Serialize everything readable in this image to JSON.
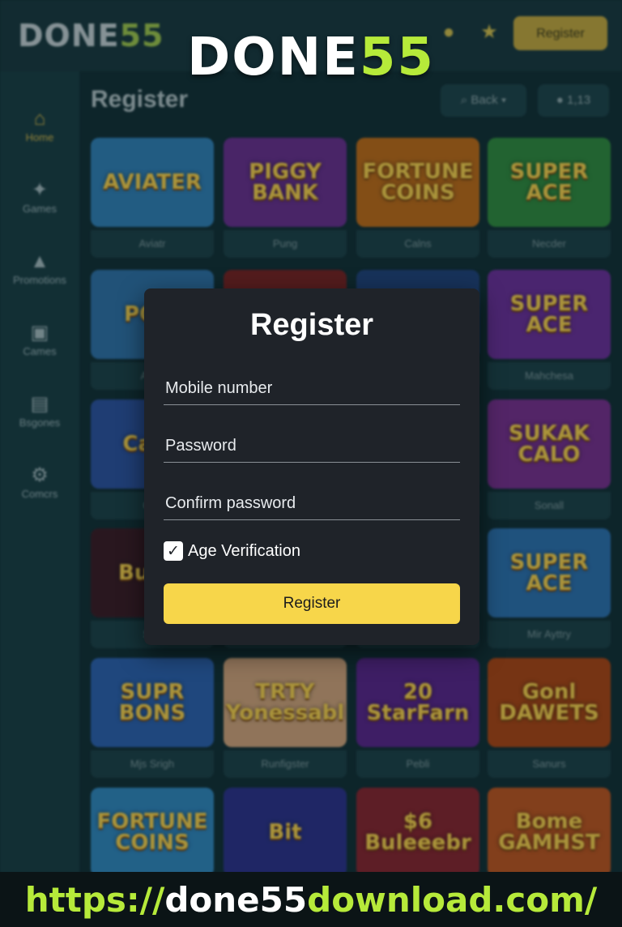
{
  "brand": {
    "prefix": "DONE",
    "suffix": "55"
  },
  "header": {
    "bell_icon": "bell-icon",
    "star_icon": "star-badge-icon",
    "register_label": "Register"
  },
  "sidebar": {
    "items": [
      {
        "label": "Home",
        "icon": "home-icon"
      },
      {
        "label": "Games",
        "icon": "games-icon"
      },
      {
        "label": "Promotions",
        "icon": "promotions-icon"
      },
      {
        "label": "Cames",
        "icon": "image-icon"
      },
      {
        "label": "Bsgones",
        "icon": "wallet-icon"
      },
      {
        "label": "Comcrs",
        "icon": "gear-icon"
      }
    ]
  },
  "main": {
    "heading": "Register",
    "filter_label": "Back",
    "count_label": "1,13",
    "tiles": [
      {
        "art": "AVIATER",
        "caption": "Aviatr",
        "bg": "#2f7fb8"
      },
      {
        "art": "PIGGY BANK",
        "caption": "Pung",
        "bg": "#6a2a8e"
      },
      {
        "art": "FORTUNE COINS",
        "caption": "Calns",
        "bg": "#c46a12"
      },
      {
        "art": "SUPER ACE",
        "caption": "Necder",
        "bg": "#2f8a3a"
      },
      {
        "art": "POW",
        "caption": "Asirs",
        "bg": "#2d6fa8"
      },
      {
        "art": "",
        "caption": "",
        "bg": "#7a1d1d"
      },
      {
        "art": "",
        "caption": "",
        "bg": "#1f3f7a"
      },
      {
        "art": "SUPER ACE",
        "caption": "Mahchesa",
        "bg": "#6d2a9a"
      },
      {
        "art": "Cabo",
        "caption": "Cas",
        "bg": "#2a4fa0"
      },
      {
        "art": "",
        "caption": "",
        "bg": "#1b3e4a"
      },
      {
        "art": "",
        "caption": "",
        "bg": "#1b3e4a"
      },
      {
        "art": "SUKAK CALO",
        "caption": "Sonall",
        "bg": "#7a2a8e"
      },
      {
        "art": "Bu So",
        "caption": "Sarl",
        "bg": "#3a1620"
      },
      {
        "art": "",
        "caption": "",
        "bg": "#1b3e4a"
      },
      {
        "art": "",
        "caption": "",
        "bg": "#1b3e4a"
      },
      {
        "art": "SUPER ACE",
        "caption": "Mir Ayttry",
        "bg": "#2b6fb0"
      },
      {
        "art": "SUPR BONS",
        "caption": "Mjs Srigh",
        "bg": "#2a5fb0"
      },
      {
        "art": "TRTY Yonessabl",
        "caption": "Runfigster",
        "bg": "#d8a57a"
      },
      {
        "art": "20 StarFarn",
        "caption": "Pebli",
        "bg": "#5a1f8a"
      },
      {
        "art": "Gonl DAWETS",
        "caption": "Sanurs",
        "bg": "#b0420e"
      },
      {
        "art": "FORTUNE COINS",
        "caption": "",
        "bg": "#2f86c0"
      },
      {
        "art": "Bit",
        "caption": "",
        "bg": "#2a2d8a"
      },
      {
        "art": "$6 Buleeebr",
        "caption": "",
        "bg": "#8a1f2a"
      },
      {
        "art": "Bome GAMHST",
        "caption": "",
        "bg": "#c2521a"
      }
    ]
  },
  "modal": {
    "title": "Register",
    "mobile_placeholder": "Mobile number",
    "password_placeholder": "Password",
    "confirm_placeholder": "Confirm password",
    "age_label": "Age Verification",
    "age_checked": true,
    "check_glyph": "✓",
    "submit_label": "Register"
  },
  "footer": {
    "url_before": "https://",
    "url_accent": "done55",
    "url_after": "download.com/"
  },
  "colors": {
    "accent_yellow": "#f7d64a",
    "accent_green": "#b6ea3a",
    "modal_bg": "#1f2329"
  }
}
